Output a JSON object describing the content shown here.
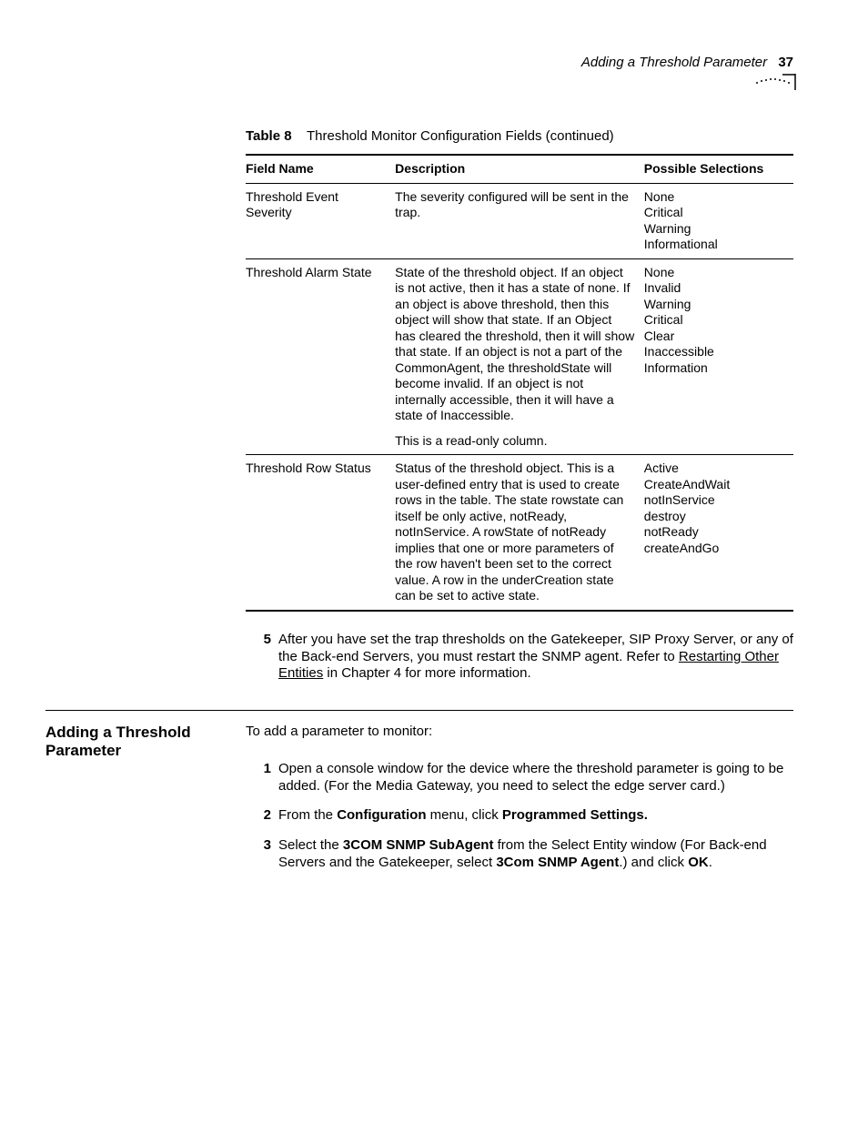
{
  "header": {
    "title": "Adding a Threshold Parameter",
    "page_number": "37"
  },
  "table_caption": {
    "label": "Table 8",
    "title": "Threshold Monitor Configuration Fields (continued)"
  },
  "table": {
    "headers": {
      "field": "Field Name",
      "desc": "Description",
      "sel": "Possible Selections"
    },
    "rows": [
      {
        "field": "Threshold Event Severity",
        "desc": "The severity configured will be sent in the trap.",
        "sel": "None\nCritical\nWarning\nInformational"
      },
      {
        "field": "Threshold Alarm State",
        "desc": "State of the threshold object. If an object is not active, then it has a state of none. If an object is above threshold, then this object will show that state. If an Object has cleared the threshold, then it will show that state. If an object is not a part of the CommonAgent, the thresholdState will become invalid. If an object is not internally accessible, then it will have a state of Inaccessible.",
        "desc_sub": "This is a read-only column.",
        "sel": "None\nInvalid\nWarning\nCritical\nClear\nInaccessible\nInformation"
      },
      {
        "field": "Threshold Row Status",
        "desc": "Status of the threshold object. This is a user-defined entry that is used to create rows in the table. The state rowstate can itself be only active, notReady, notInService. A rowState of notReady implies that one or more parameters of the row haven't been set to the correct value. A row in the underCreation state can be set to active state.",
        "sel": "Active\nCreateAndWait\nnotInService\ndestroy\nnotReady\ncreateAndGo"
      }
    ]
  },
  "step5": {
    "num": "5",
    "text_pre": "After you have set the trap thresholds on the Gatekeeper, SIP Proxy Server, or any of the Back-end Servers, you must restart the SNMP agent. Refer to ",
    "link": "Restarting Other Entities",
    "text_post": " in Chapter 4 for more information."
  },
  "section": {
    "title": "Adding a Threshold Parameter",
    "intro": "To add a parameter to monitor:",
    "steps": [
      {
        "num": "1",
        "parts": [
          {
            "t": "plain",
            "v": "Open a console window for the device where the threshold parameter is going to be added. (For the Media Gateway, you need to select the edge server card.)"
          }
        ]
      },
      {
        "num": "2",
        "parts": [
          {
            "t": "plain",
            "v": "From the "
          },
          {
            "t": "bold",
            "v": "Configuration"
          },
          {
            "t": "plain",
            "v": " menu, click "
          },
          {
            "t": "bold",
            "v": "Programmed Settings."
          }
        ]
      },
      {
        "num": "3",
        "parts": [
          {
            "t": "plain",
            "v": "Select the "
          },
          {
            "t": "bold",
            "v": "3COM SNMP SubAgent"
          },
          {
            "t": "plain",
            "v": " from the Select Entity window (For Back-end Servers and the Gatekeeper, select "
          },
          {
            "t": "bold",
            "v": "3Com SNMP Agent"
          },
          {
            "t": "plain",
            "v": ".) and click "
          },
          {
            "t": "bold",
            "v": "OK"
          },
          {
            "t": "plain",
            "v": "."
          }
        ]
      }
    ]
  }
}
